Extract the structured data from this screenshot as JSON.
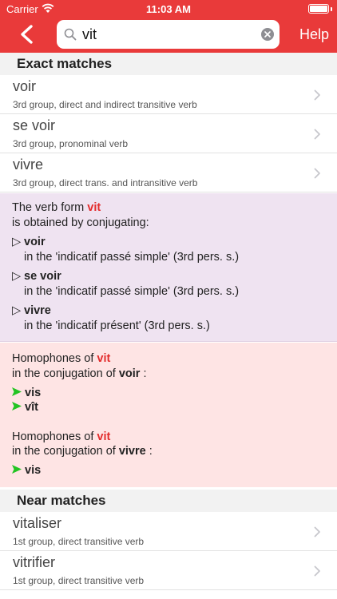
{
  "status_bar": {
    "carrier": "Carrier",
    "time": "11:03 AM",
    "battery_percent": 100
  },
  "nav": {
    "search_value": "vit",
    "help_label": "Help"
  },
  "sections": {
    "exact": "Exact matches",
    "near": "Near matches"
  },
  "exact_matches": [
    {
      "word": "voir",
      "desc": "3rd group, direct and indirect transitive verb"
    },
    {
      "word": "se voir",
      "desc": "3rd group, pronominal verb"
    },
    {
      "word": "vivre",
      "desc": "3rd group, direct trans. and intransitive verb"
    }
  ],
  "conjugation": {
    "line1_prefix": "The verb form ",
    "form": "vit",
    "line2": "is obtained by conjugating:",
    "items": [
      {
        "verb": "voir",
        "detail": "in the 'indicatif passé simple' (3rd pers. s.)"
      },
      {
        "verb": "se voir",
        "detail": "in the 'indicatif passé simple' (3rd pers. s.)"
      },
      {
        "verb": "vivre",
        "detail": "in the 'indicatif présent' (3rd pers. s.)"
      }
    ]
  },
  "homophones": [
    {
      "prefix": "Homophones of ",
      "form": "vit",
      "conj_prefix": "in the conjugation of ",
      "verb": "voir",
      "suffix": " :",
      "words": [
        "vis",
        "vît"
      ]
    },
    {
      "prefix": "Homophones of ",
      "form": "vit",
      "conj_prefix": "in the conjugation of ",
      "verb": "vivre",
      "suffix": " :",
      "words": [
        "vis"
      ]
    }
  ],
  "near_matches": [
    {
      "word": "vitaliser",
      "desc": "1st group, direct transitive verb"
    },
    {
      "word": "vitrifier",
      "desc": "1st group, direct transitive verb"
    }
  ],
  "colors": {
    "brand": "#e93a3a",
    "highlight": "#e32c2c",
    "conj_bg": "#efe3f1",
    "homo_bg": "#fee4e4",
    "green_arrow": "#22c422"
  }
}
